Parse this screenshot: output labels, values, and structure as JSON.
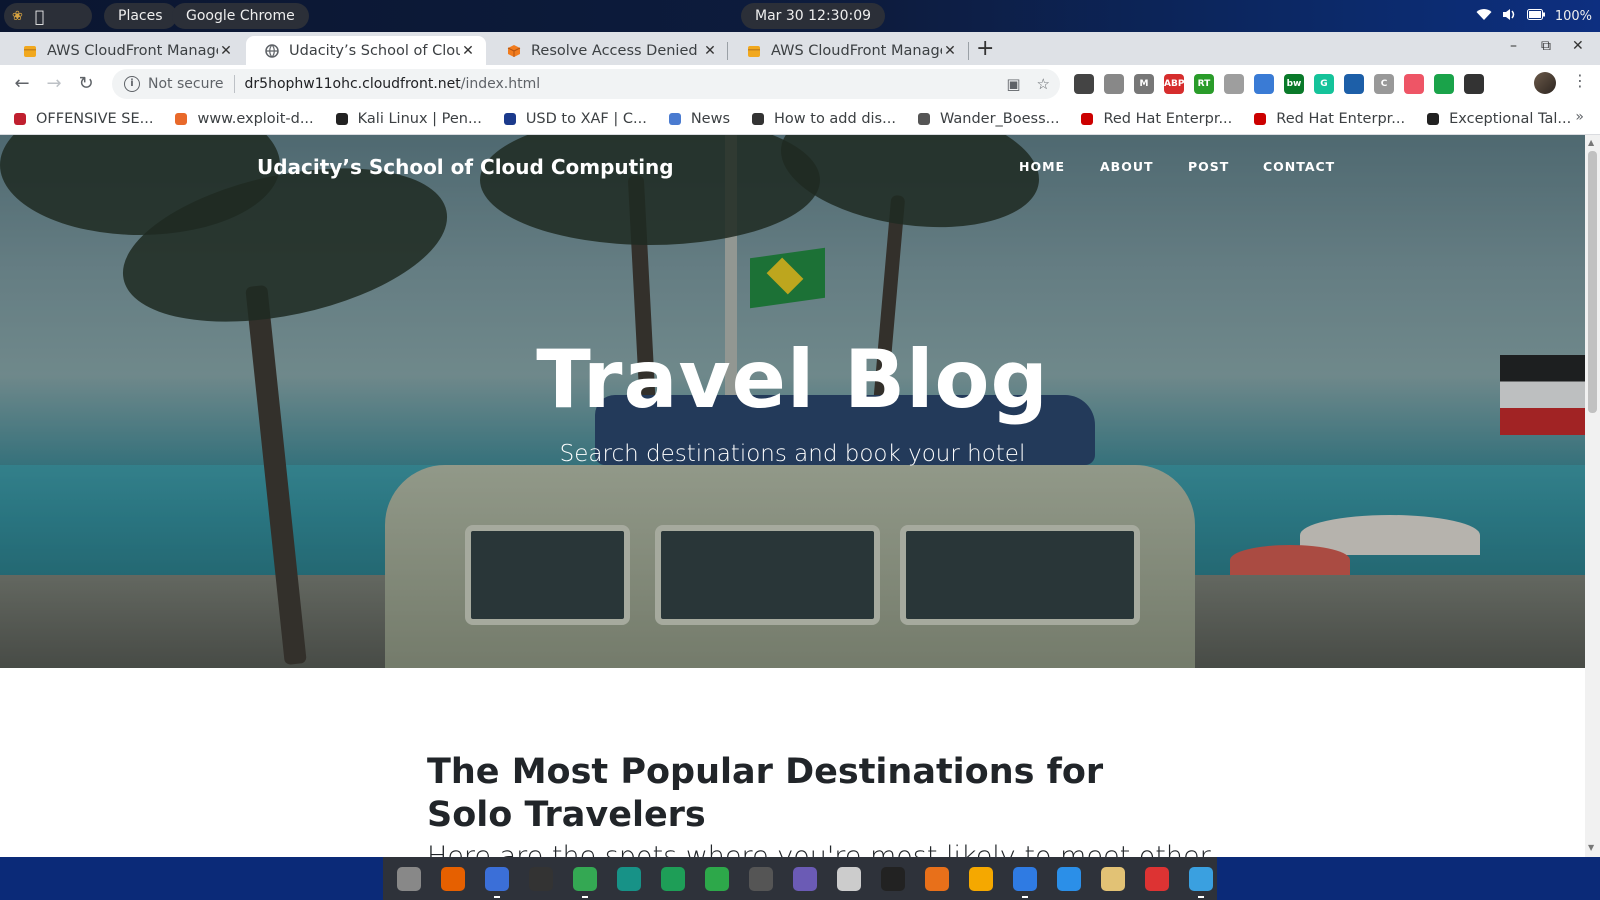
{
  "system": {
    "places": "Places",
    "active_app": "Google Chrome",
    "clock": "Mar 30  12:30:09",
    "battery": "100%"
  },
  "tabs": [
    {
      "title": "AWS CloudFront Management Console",
      "favicon": "aws-box-icon",
      "color": "#f1a81e"
    },
    {
      "title": "Udacity’s School of Cloud Computing",
      "favicon": "globe-icon",
      "color": "#5f6368"
    },
    {
      "title": "Resolve Access Denied Errors",
      "favicon": "aws-cube-icon",
      "color": "#f17c1e"
    },
    {
      "title": "AWS CloudFront Management Console",
      "favicon": "aws-box-icon",
      "color": "#f1a81e"
    }
  ],
  "address": {
    "security": "Not secure",
    "host": "dr5hophw11ohc.cloudfront.net",
    "path": "/index.html"
  },
  "bookmarks": [
    {
      "label": "OFFENSIVE SE...",
      "icon": "offsec-icon",
      "color": "#c01f2f"
    },
    {
      "label": "www.exploit-d...",
      "icon": "exploit-db-icon",
      "color": "#e8692a"
    },
    {
      "label": "Kali Linux | Pen...",
      "icon": "kali-dragon-icon",
      "color": "#222"
    },
    {
      "label": "USD to XAF | C...",
      "icon": "xe-icon",
      "color": "#1b3a8c"
    },
    {
      "label": "News",
      "icon": "news-icon",
      "color": "#4a7bd0"
    },
    {
      "label": "How to add dis...",
      "icon": "hand-icon",
      "color": "#333"
    },
    {
      "label": "Wander_Boess...",
      "icon": "globe-icon",
      "color": "#555"
    },
    {
      "label": "Red Hat Enterpr...",
      "icon": "redhat-icon",
      "color": "#cc0000"
    },
    {
      "label": "Red Hat Enterpr...",
      "icon": "redhat-icon",
      "color": "#cc0000"
    },
    {
      "label": "Exceptional Tal...",
      "icon": "briefcase-icon",
      "color": "#222"
    }
  ],
  "site": {
    "brand": "Udacity’s School of Cloud Computing",
    "nav": [
      "HOME",
      "ABOUT",
      "POST",
      "CONTACT"
    ],
    "hero_title": "Travel Blog",
    "hero_subtitle": "Search destinations and book your hotel",
    "post_title": "The Most Popular Destinations for Solo Travelers",
    "post_subtitle": "Here are the spots where you're most likely to meet other"
  },
  "extensions": [
    {
      "icon": "download-ext-icon",
      "color": "#444",
      "text": ""
    },
    {
      "icon": "cube-ext-icon",
      "color": "#888",
      "text": ""
    },
    {
      "icon": "m-ext-icon",
      "color": "#777",
      "text": "M"
    },
    {
      "icon": "adblock-ext-icon",
      "color": "#d62d2d",
      "text": "ABP"
    },
    {
      "icon": "rt-ext-icon",
      "color": "#2a9c2a",
      "text": "RT"
    },
    {
      "icon": "doc-ext-icon",
      "color": "#9e9e9e",
      "text": ""
    },
    {
      "icon": "sitemap-ext-icon",
      "color": "#3a7bd5",
      "text": ""
    },
    {
      "icon": "bw-ext-icon",
      "color": "#0a7a2a",
      "text": "bw"
    },
    {
      "icon": "grammarly-ext-icon",
      "color": "#15c39a",
      "text": "G"
    },
    {
      "icon": "tampermonkey-ext-icon",
      "color": "#1d5fa8",
      "text": ""
    },
    {
      "icon": "c-ext-icon",
      "color": "#999",
      "text": "C"
    },
    {
      "icon": "cast-ext-icon",
      "color": "#e56",
      "text": ""
    },
    {
      "icon": "green-dot-ext-icon",
      "color": "#1aa34a",
      "text": ""
    },
    {
      "icon": "puzzle-ext-icon",
      "color": "#333",
      "text": ""
    }
  ],
  "dock": [
    {
      "icon": "launcher-icon",
      "color": "#888",
      "running": false
    },
    {
      "icon": "firefox-icon",
      "color": "#e66000",
      "running": false
    },
    {
      "icon": "files-icon",
      "color": "#3b6fd8",
      "running": true
    },
    {
      "icon": "terminal-icon",
      "color": "#333",
      "running": false
    },
    {
      "icon": "chrome-icon",
      "color": "#34a853",
      "running": true
    },
    {
      "icon": "gitkraken-icon",
      "color": "#179287",
      "running": false
    },
    {
      "icon": "spreadsheet-icon",
      "color": "#1e9e57",
      "running": false
    },
    {
      "icon": "kali-icon",
      "color": "#2da84a",
      "running": false
    },
    {
      "icon": "bug-icon",
      "color": "#555",
      "running": false
    },
    {
      "icon": "archive-icon",
      "color": "#6b5bb5",
      "running": false
    },
    {
      "icon": "settings-icon",
      "color": "#ccc",
      "running": false
    },
    {
      "icon": "mask-icon",
      "color": "#222",
      "running": false
    },
    {
      "icon": "slides-icon",
      "color": "#e8701a",
      "running": false
    },
    {
      "icon": "keep-icon",
      "color": "#f5a800",
      "running": false
    },
    {
      "icon": "docs-icon",
      "color": "#2f7be3",
      "running": true
    },
    {
      "icon": "vscode-icon",
      "color": "#2b8fe8",
      "running": false
    },
    {
      "icon": "editor-icon",
      "color": "#e2c275",
      "running": false
    },
    {
      "icon": "screenshot-icon",
      "color": "#d33",
      "running": false
    },
    {
      "icon": "network-icon",
      "color": "#3aa0e0",
      "running": true
    }
  ]
}
